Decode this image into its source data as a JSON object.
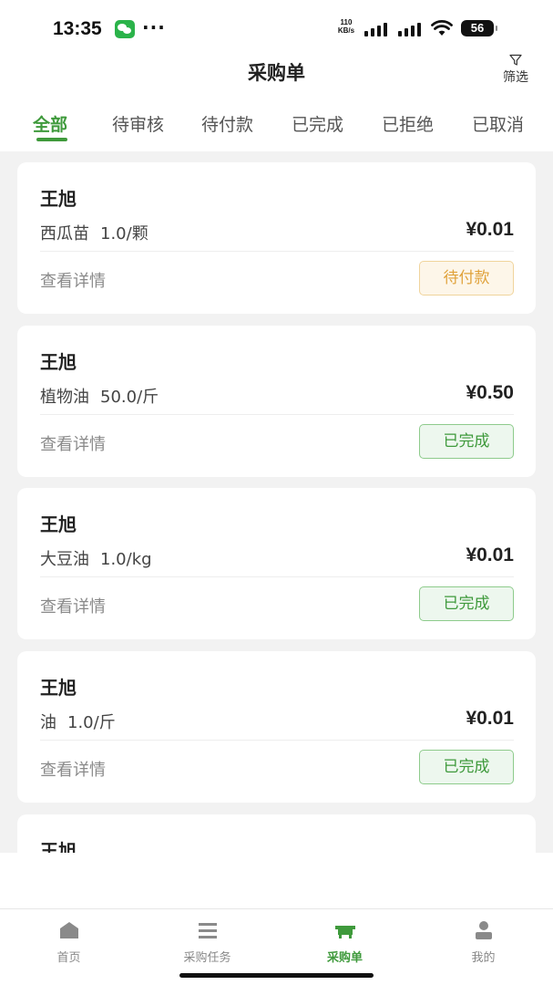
{
  "status_bar": {
    "time": "13:35",
    "more": "···",
    "net_speed_value": "110",
    "net_speed_unit": "KB/s",
    "battery": "56"
  },
  "header": {
    "title": "采购单",
    "filter_label": "筛选"
  },
  "tabs": [
    {
      "label": "全部",
      "active": true
    },
    {
      "label": "待审核",
      "active": false
    },
    {
      "label": "待付款",
      "active": false
    },
    {
      "label": "已完成",
      "active": false
    },
    {
      "label": "已拒绝",
      "active": false
    },
    {
      "label": "已取消",
      "active": false
    }
  ],
  "orders": [
    {
      "name": "王旭",
      "product": "西瓜苗",
      "qty": "1.0/颗",
      "price": "¥0.01",
      "detail": "查看详情",
      "status": "待付款",
      "status_type": "pending"
    },
    {
      "name": "王旭",
      "product": "植物油",
      "qty": "50.0/斤",
      "price": "¥0.50",
      "detail": "查看详情",
      "status": "已完成",
      "status_type": "done"
    },
    {
      "name": "王旭",
      "product": "大豆油",
      "qty": "1.0/kg",
      "price": "¥0.01",
      "detail": "查看详情",
      "status": "已完成",
      "status_type": "done"
    },
    {
      "name": "王旭",
      "product": "油",
      "qty": "1.0/斤",
      "price": "¥0.01",
      "detail": "查看详情",
      "status": "已完成",
      "status_type": "done"
    },
    {
      "name": "王旭"
    }
  ],
  "tabbar": [
    {
      "label": "首页",
      "icon": "home-icon",
      "active": false
    },
    {
      "label": "采购任务",
      "icon": "list-icon",
      "active": false
    },
    {
      "label": "采购单",
      "icon": "cart-icon",
      "active": true
    },
    {
      "label": "我的",
      "icon": "user-icon",
      "active": false
    }
  ],
  "colors": {
    "accent": "#3f9a3c",
    "pending_text": "#e0a23a",
    "pending_bg": "#fdf6e9",
    "done_bg": "#edf7ee",
    "page_bg": "#f2f2f2"
  }
}
